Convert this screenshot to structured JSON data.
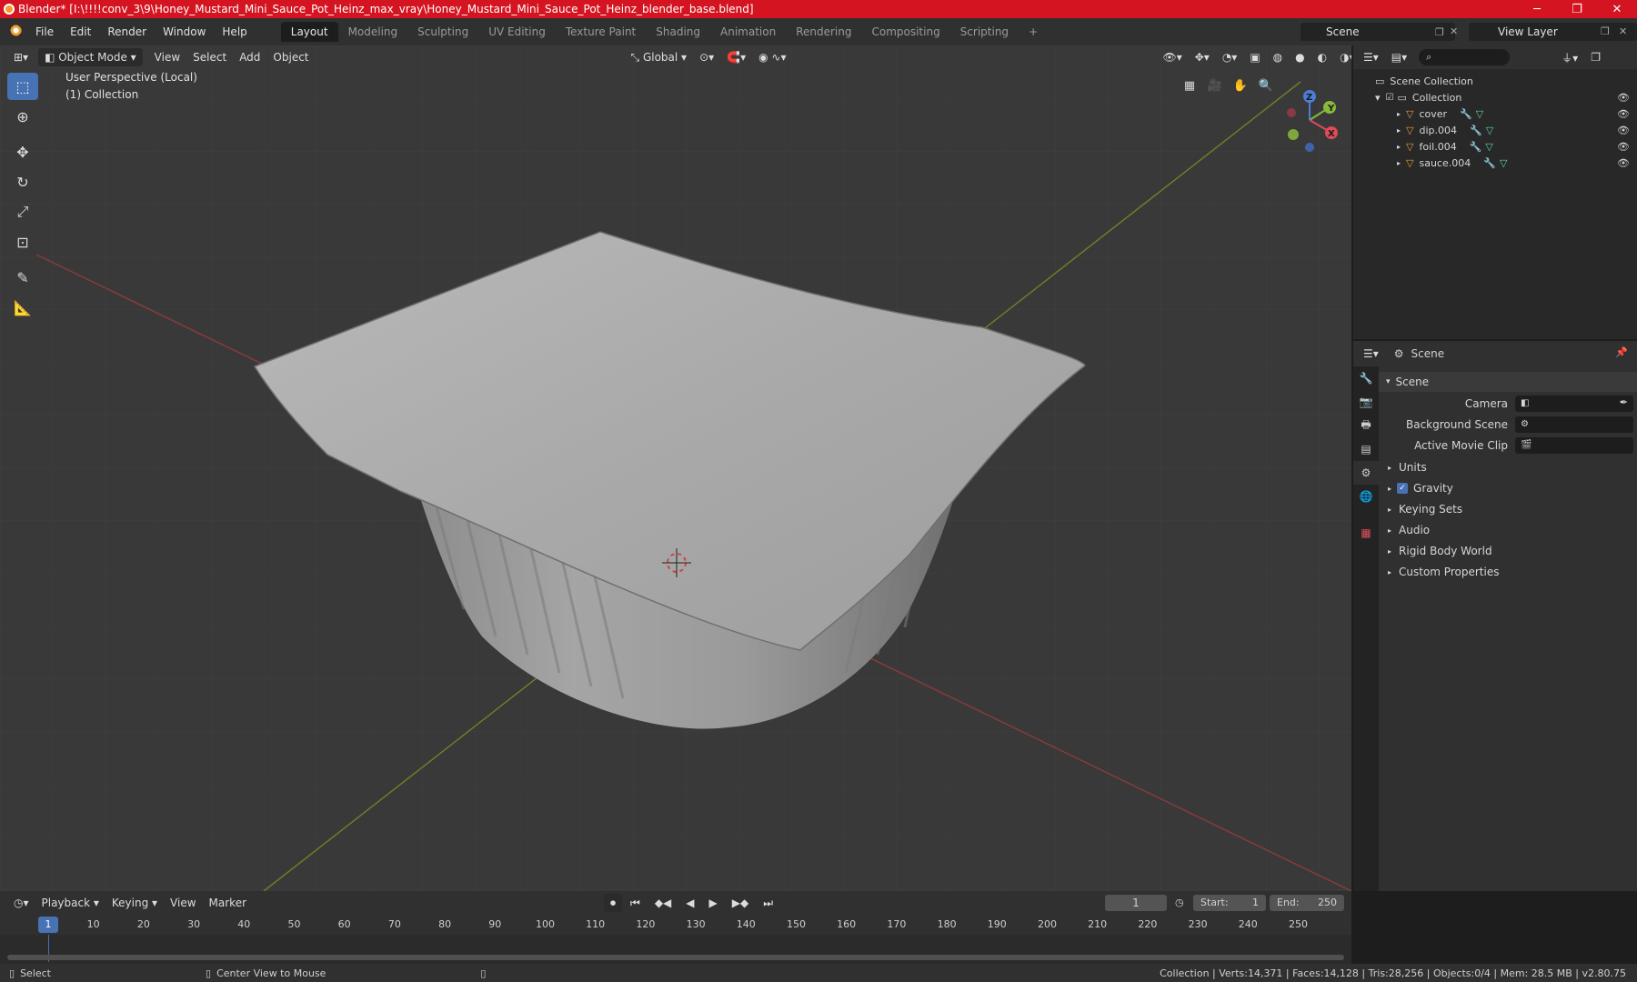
{
  "window": {
    "title": "Blender* [I:\\!!!!conv_3\\9\\Honey_Mustard_Mini_Sauce_Pot_Heinz_max_vray\\Honey_Mustard_Mini_Sauce_Pot_Heinz_blender_base.blend]",
    "minimize": "─",
    "maximize": "❐",
    "close": "✕"
  },
  "menu": [
    "File",
    "Edit",
    "Render",
    "Window",
    "Help"
  ],
  "workspaces": [
    "Layout",
    "Modeling",
    "Sculpting",
    "UV Editing",
    "Texture Paint",
    "Shading",
    "Animation",
    "Rendering",
    "Compositing",
    "Scripting"
  ],
  "active_workspace": "Layout",
  "add_workspace": "+",
  "scene_name": "Scene",
  "view_layer": "View Layer",
  "viewport": {
    "mode": "Object Mode",
    "menus": [
      "View",
      "Select",
      "Add",
      "Object"
    ],
    "orientation": "Global",
    "perspective_label": "User Perspective (Local)",
    "collection_label": "(1) Collection",
    "gizmo": {
      "x": "X",
      "y": "Y",
      "z": "Z"
    }
  },
  "outliner": {
    "root": "Scene Collection",
    "collection": "Collection",
    "objects": [
      "cover",
      "dip.004",
      "foil.004",
      "sauce.004"
    ]
  },
  "properties": {
    "context": "Scene",
    "panel": "Scene",
    "camera_label": "Camera",
    "background_scene_label": "Background Scene",
    "active_movie_clip_label": "Active Movie Clip",
    "sections": [
      "Units",
      "Gravity",
      "Keying Sets",
      "Audio",
      "Rigid Body World",
      "Custom Properties"
    ],
    "gravity_checked": true
  },
  "timeline": {
    "menus": [
      "Playback",
      "Keying",
      "View",
      "Marker"
    ],
    "current_frame": "1",
    "start_label": "Start:",
    "start_value": "1",
    "end_label": "End:",
    "end_value": "250",
    "ruler": [
      "1",
      "10",
      "20",
      "30",
      "40",
      "50",
      "60",
      "70",
      "80",
      "90",
      "100",
      "110",
      "120",
      "130",
      "140",
      "150",
      "160",
      "170",
      "180",
      "190",
      "200",
      "210",
      "220",
      "230",
      "240",
      "250"
    ]
  },
  "status": {
    "left_action": "Select",
    "middle_action": "Center View to Mouse",
    "stats": "Collection | Verts:14,371 | Faces:14,128 | Tris:28,256 | Objects:0/4 | Mem: 28.5 MB | v2.80.75"
  }
}
